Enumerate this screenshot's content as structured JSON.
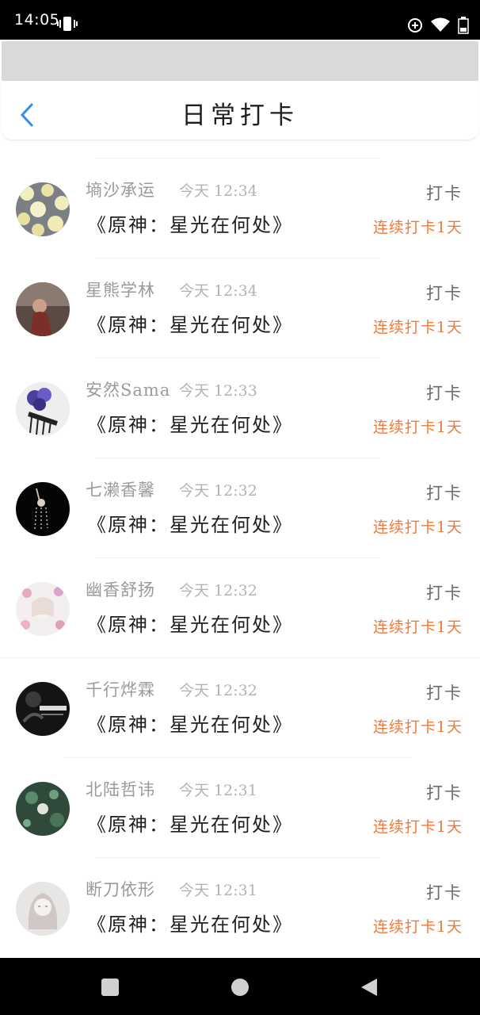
{
  "status_bar": {
    "time": "14:05"
  },
  "header": {
    "title": "日常打卡"
  },
  "colors": {
    "accent_blue": "#2f8fea",
    "streak_orange": "#ef7a3b"
  },
  "items": [
    {
      "name": "墒沙承运",
      "time": "今天 12:34",
      "content": "《原神：星光在何处》",
      "action": "打卡",
      "streak": "连续打卡1天"
    },
    {
      "name": "星熊学林",
      "time": "今天 12:34",
      "content": "《原神：星光在何处》",
      "action": "打卡",
      "streak": "连续打卡1天"
    },
    {
      "name": "安然Sama",
      "time": "今天 12:33",
      "content": "《原神：星光在何处》",
      "action": "打卡",
      "streak": "连续打卡1天"
    },
    {
      "name": "七濑香馨",
      "time": "今天 12:32",
      "content": "《原神：星光在何处》",
      "action": "打卡",
      "streak": "连续打卡1天"
    },
    {
      "name": "幽香舒扬",
      "time": "今天 12:32",
      "content": "《原神：星光在何处》",
      "action": "打卡",
      "streak": "连续打卡1天"
    },
    {
      "name": "千行烨霖",
      "time": "今天 12:32",
      "content": "《原神：星光在何处》",
      "action": "打卡",
      "streak": "连续打卡1天"
    },
    {
      "name": "北陆哲讳",
      "time": "今天 12:31",
      "content": "《原神：星光在何处》",
      "action": "打卡",
      "streak": "连续打卡1天"
    },
    {
      "name": "断刀依形",
      "time": "今天 12:31",
      "content": "《原神：星光在何处》",
      "action": "打卡",
      "streak": "连续打卡1天"
    }
  ]
}
